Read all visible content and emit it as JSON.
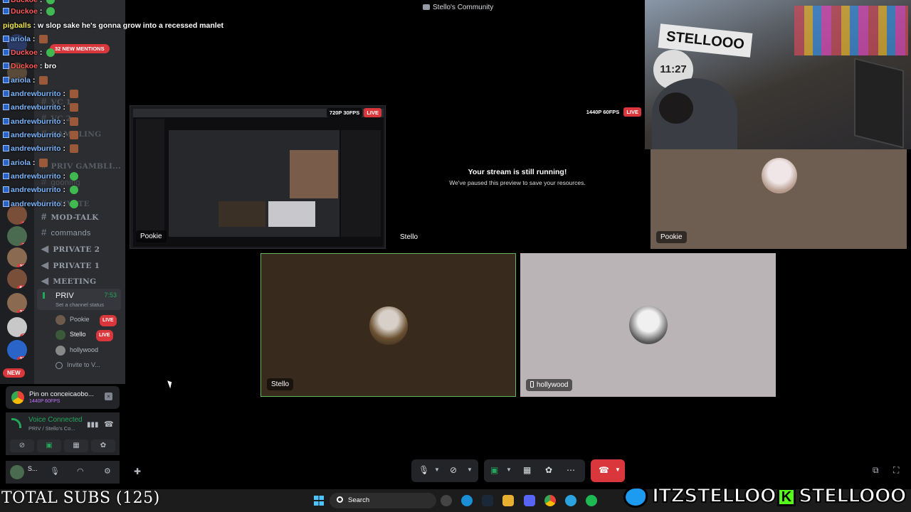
{
  "window_title": "Stello's Community",
  "chat": [
    {
      "user": "Duckoe",
      "msg": "",
      "color": "red"
    },
    {
      "user": "pigballs",
      "msg": "w slop sake he's gonna grow into a recessed manlet",
      "color": "yel"
    },
    {
      "user": "ariola",
      "msg": "",
      "color": "blue"
    },
    {
      "user": "Duckoe",
      "msg": "",
      "color": "red"
    },
    {
      "user": "Duckoe",
      "msg": "bro",
      "color": "red"
    },
    {
      "user": "ariola",
      "msg": "",
      "color": "blue"
    },
    {
      "user": "andrewburrito",
      "msg": "",
      "color": "blue"
    },
    {
      "user": "andrewburrito",
      "msg": "",
      "color": "blue"
    },
    {
      "user": "andrewburrito",
      "msg": "",
      "color": "blue"
    },
    {
      "user": "andrewburrito",
      "msg": "",
      "color": "blue"
    },
    {
      "user": "andrewburrito",
      "msg": "",
      "color": "blue"
    },
    {
      "user": "ariola",
      "msg": "",
      "color": "blue"
    },
    {
      "user": "andrewburrito",
      "msg": "",
      "color": "blue"
    },
    {
      "user": "andrewburrito",
      "msg": "",
      "color": "blue"
    },
    {
      "user": "andrewburrito",
      "msg": "",
      "color": "blue"
    }
  ],
  "sidebar": {
    "new_mentions": "32 NEW MENTIONS",
    "channels_faded": [
      "VC 1",
      "VC 2",
      "GAMBLING",
      "PRIV GAMBLI...",
      "gooning",
      "PRIVATE"
    ],
    "channels": [
      "MOD-TALK",
      "commands",
      "PRIVATE 2",
      "PRIVATE 1",
      "MEETING"
    ],
    "active_channel": {
      "name": "PRIV",
      "time": "7:53",
      "status": "Set a channel status"
    },
    "members": [
      {
        "name": "Pookie",
        "live": "LIVE"
      },
      {
        "name": "Stello",
        "live": "LIVE"
      },
      {
        "name": "hollywood",
        "live": ""
      }
    ],
    "invite": "Invite to V...",
    "server_badges": [
      "62",
      "3",
      "10",
      "32",
      "272",
      "642",
      "216",
      "93",
      "383"
    ],
    "new_label": "NEW"
  },
  "pin": {
    "title": "Pin on conceicaobo...",
    "sub": "1440P 60FPS"
  },
  "voice": {
    "status": "Voice Connected",
    "location": "PRIV / Stello's Co..."
  },
  "user": {
    "name": "S..."
  },
  "tiles": {
    "pookie_stream": {
      "label": "Pookie",
      "quality": "720P 30FPS",
      "live": "LIVE"
    },
    "stello_stream": {
      "label": "Stello",
      "quality": "1440P 60FPS",
      "live": "LIVE",
      "msg1": "Your stream is still running!",
      "msg2": "We've paused this preview to save your resources."
    },
    "pookie_cam": {
      "label": "Pookie"
    },
    "stello_cam": {
      "label": "Stello"
    },
    "holly_cam": {
      "label": "hollywood"
    }
  },
  "webcam": {
    "banner": "STELLOOO",
    "clock": "11:27"
  },
  "overlay": {
    "subs": "TOTAL SUBS (125)",
    "twitter": "ITZSTELLOO",
    "kick_k": "K",
    "kick": "STELLOOO"
  },
  "taskbar": {
    "search": "Search"
  },
  "colors": {
    "accent_green": "#23a55a",
    "live_red": "#da373c",
    "kick_green": "#53fc18",
    "twitter_blue": "#1d9bf0"
  }
}
